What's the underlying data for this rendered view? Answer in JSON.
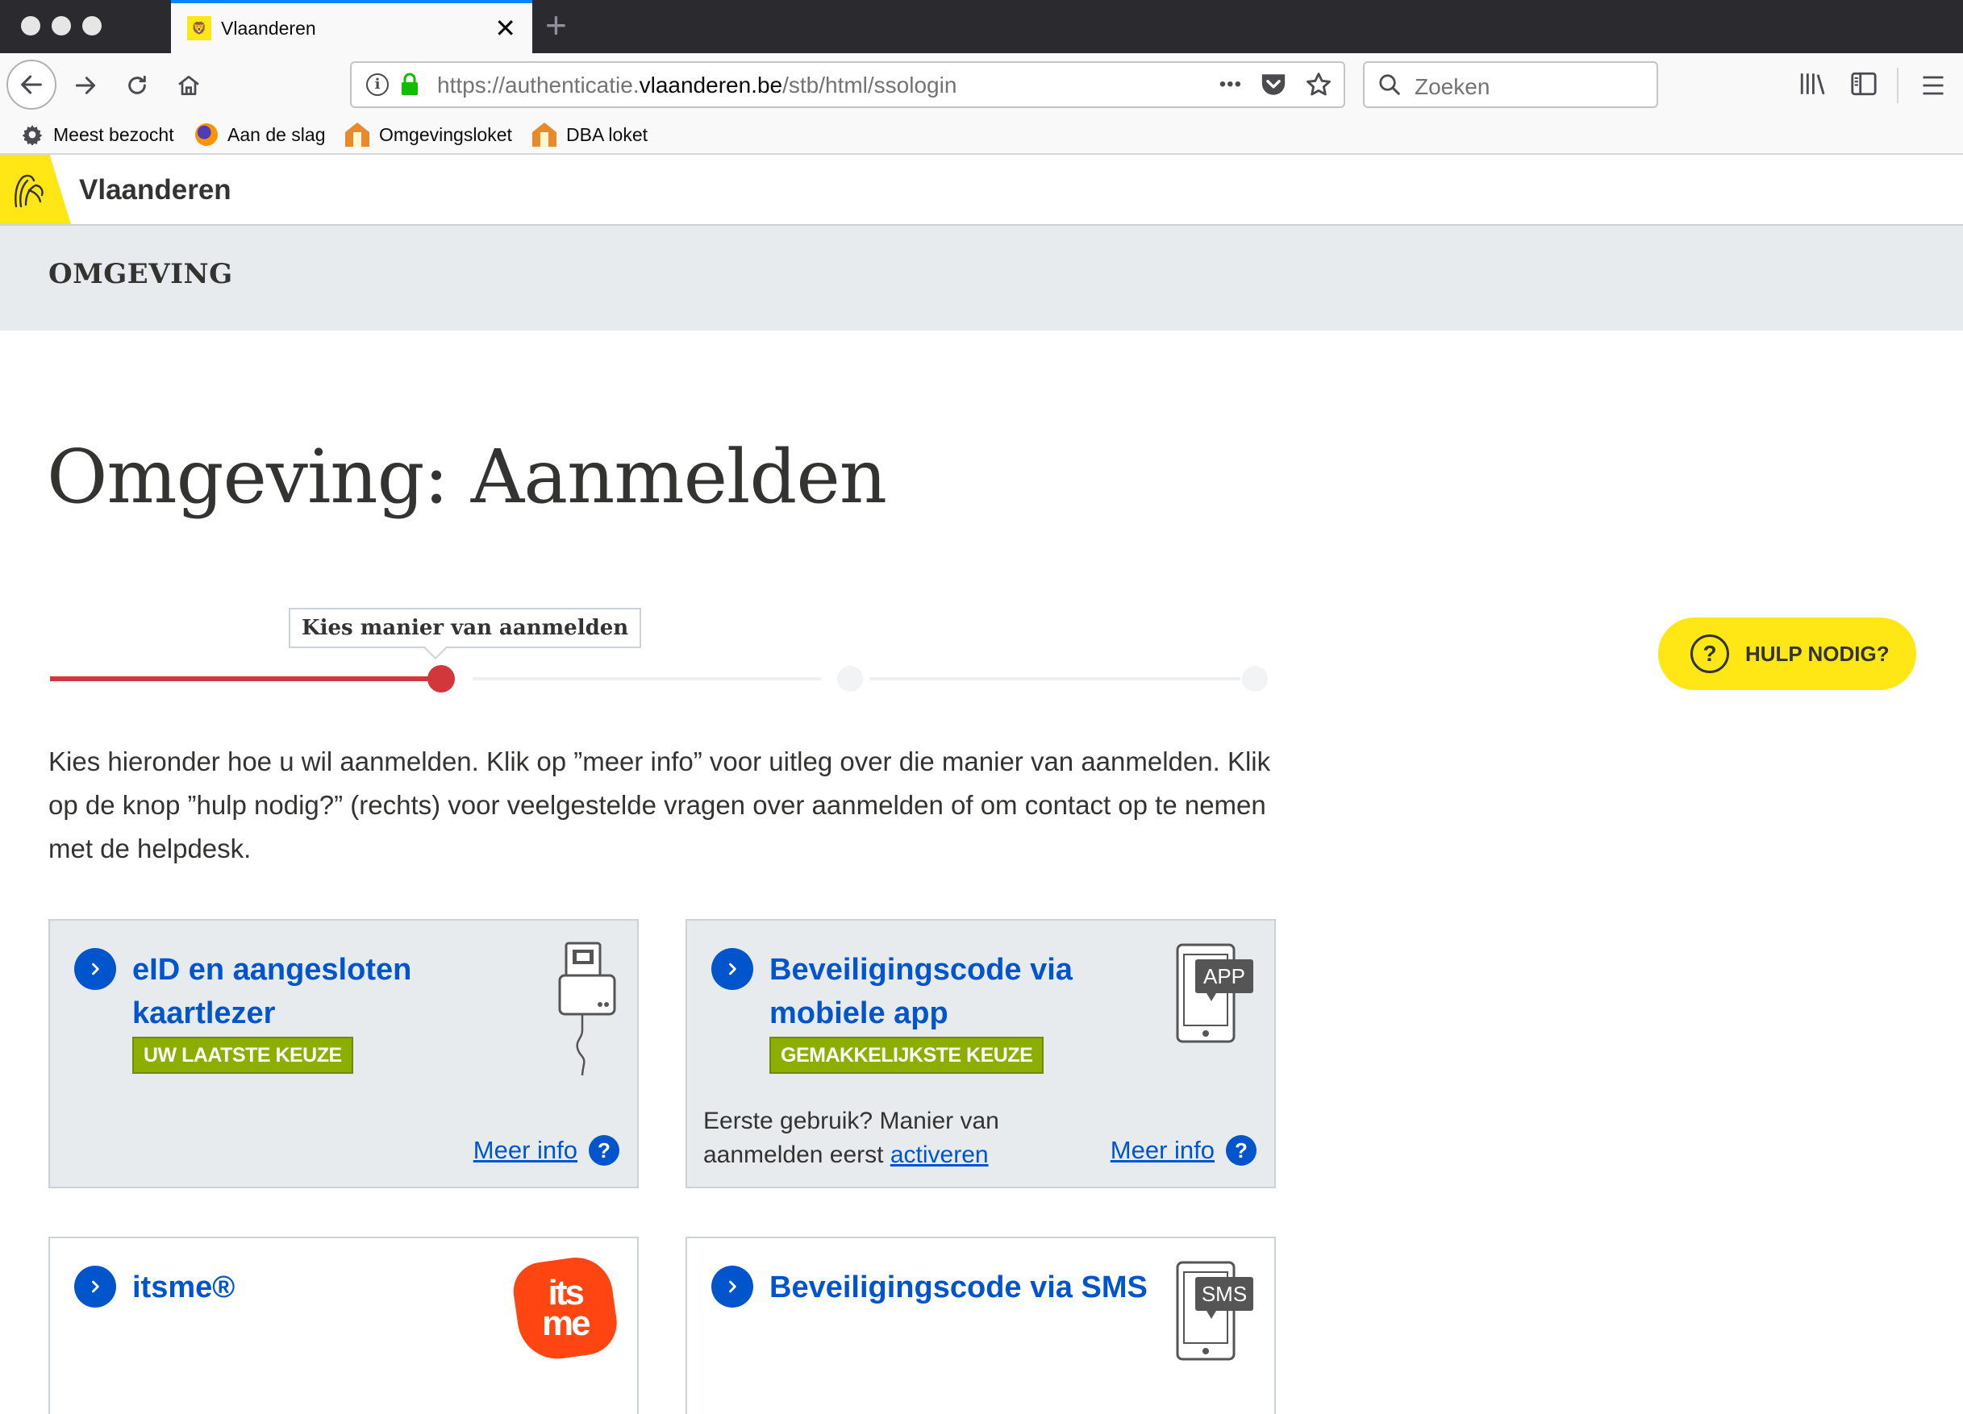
{
  "browser": {
    "tab_title": "Vlaanderen",
    "tab_close": "✕",
    "new_tab": "+",
    "url_prefix": "https://authenticatie.",
    "url_host": "vlaanderen.be",
    "url_path": "/stb/html/ssologin",
    "url_more": "•••",
    "search_placeholder": "Zoeken",
    "bookmarks": [
      {
        "label": "Meest bezocht"
      },
      {
        "label": "Aan de slag"
      },
      {
        "label": "Omgevingsloket"
      },
      {
        "label": "DBA loket"
      }
    ]
  },
  "site": {
    "brand": "Vlaanderen",
    "section": "OMGEVING"
  },
  "main": {
    "title": "Omgeving: Aanmelden",
    "step_label": "Kies manier van aanmelden",
    "steps_total": 3,
    "step_current": 1,
    "help_label": "HULP NODIG?",
    "help_icon": "?",
    "intro": "Kies hieronder hoe u wil aanmelden. Klik op ”meer info” voor uitleg over die manier van aanmelden. Klik op de knop ”hulp nodig?” (rechts) voor veelgestelde vragen over aanmelden of om contact op te nemen met de helpdesk."
  },
  "cards": [
    {
      "title": "eID en aangesloten kaartlezer",
      "badge": "UW LAATSTE KEUZE",
      "meer_info": "Meer info",
      "icon": "card-reader-icon"
    },
    {
      "title": "Beveiligingscode via mobiele app",
      "badge": "GEMAKKELIJKSTE KEUZE",
      "first_use_text": "Eerste gebruik? Manier van aanmelden eerst",
      "first_use_link": "activeren",
      "meer_info": "Meer info",
      "icon_label": "APP"
    },
    {
      "title": "itsme®",
      "logo_text_1": "its",
      "logo_text_2": "me"
    },
    {
      "title": "Beveiligingscode via SMS",
      "icon_label": "SMS"
    }
  ],
  "colors": {
    "accent_blue": "#0055cc",
    "brand_yellow": "#ffe615",
    "progress_red": "#d2373c",
    "badge_green": "#8bae00",
    "itsme_orange": "#ff4612"
  }
}
